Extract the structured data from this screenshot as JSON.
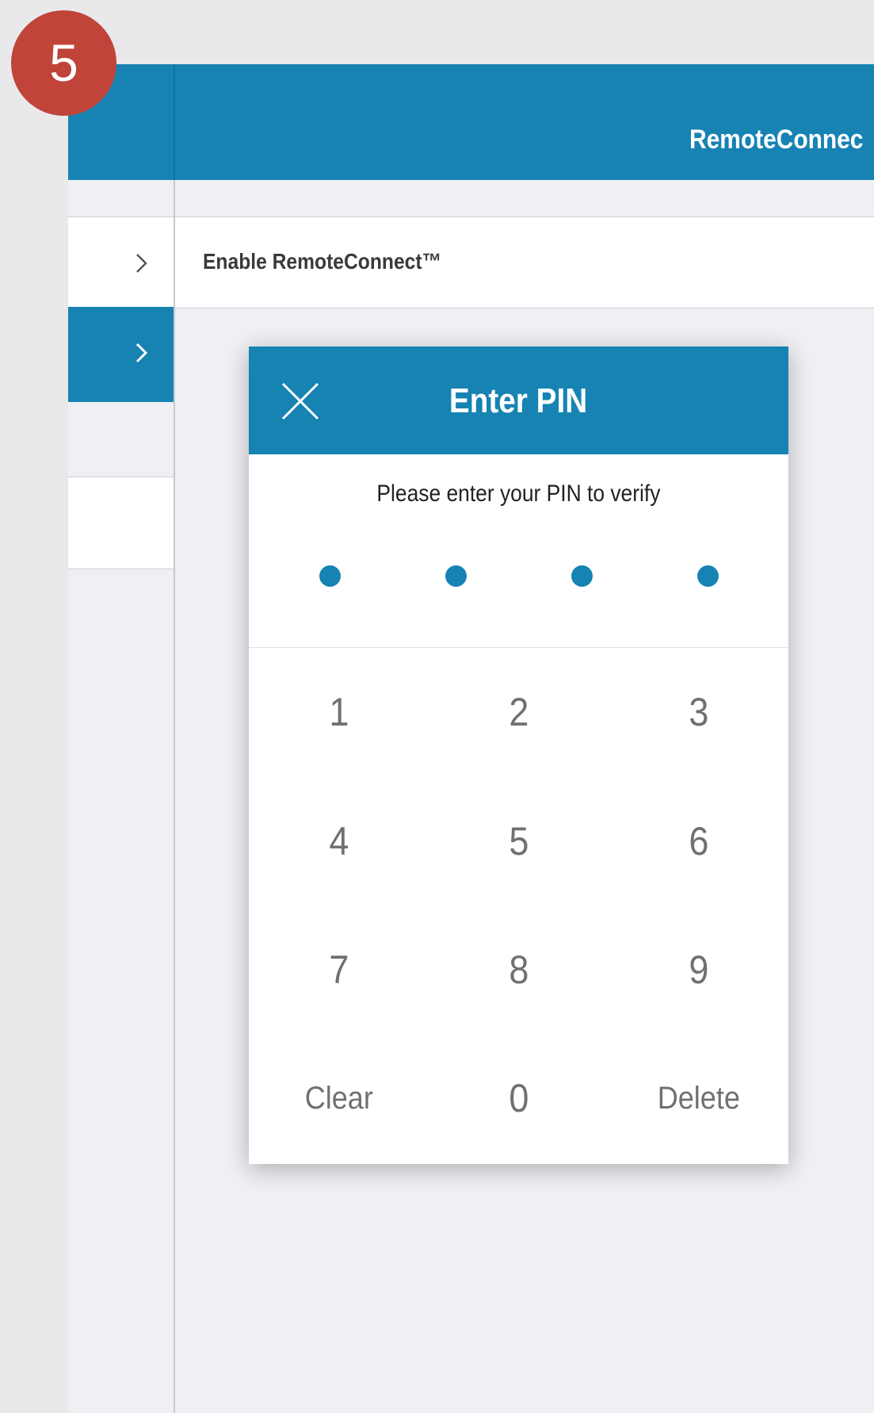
{
  "step_badge": "5",
  "top_bar": {
    "title": "RemoteConnec"
  },
  "sidebar": {
    "rows": [
      {
        "icon": "chevron-right-icon",
        "selected": false
      },
      {
        "icon": "chevron-right-icon",
        "selected": true
      },
      {
        "icon": "",
        "selected": false
      }
    ]
  },
  "content": {
    "enable_row_label": "Enable RemoteConnect™"
  },
  "pin_modal": {
    "close_icon": "close-icon",
    "title": "Enter PIN",
    "instruction": "Please enter your PIN to verify",
    "entered_digits": 4,
    "keypad": {
      "k1": "1",
      "k2": "2",
      "k3": "3",
      "k4": "4",
      "k5": "5",
      "k6": "6",
      "k7": "7",
      "k8": "8",
      "k9": "9",
      "clear": "Clear",
      "k0": "0",
      "delete": "Delete"
    }
  },
  "colors": {
    "brand_blue": "#1683b3",
    "badge_red": "#c0443a",
    "background": "#efeff4",
    "keypad_text": "#707070"
  }
}
